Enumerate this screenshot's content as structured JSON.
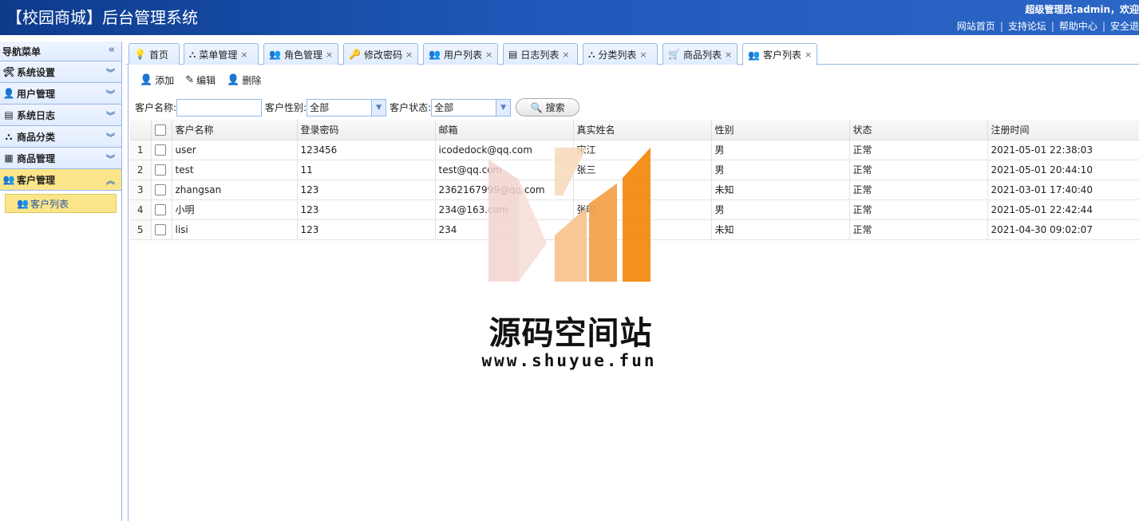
{
  "header": {
    "title": "【校园商城】后台管理系统",
    "user_info": "超级管理员:admin，欢迎",
    "links": [
      "网站首页",
      "支持论坛",
      "帮助中心",
      "安全退"
    ]
  },
  "sidebar": {
    "title": "导航菜单",
    "items": [
      {
        "label": "系统设置",
        "icon": "tools-icon"
      },
      {
        "label": "用户管理",
        "icon": "user-icon"
      },
      {
        "label": "系统日志",
        "icon": "log-icon"
      },
      {
        "label": "商品分类",
        "icon": "category-icon"
      },
      {
        "label": "商品管理",
        "icon": "goods-icon"
      },
      {
        "label": "客户管理",
        "icon": "customer-icon",
        "active": true
      }
    ],
    "sub_items": [
      {
        "label": "客户列表",
        "icon": "customer-list-icon"
      }
    ]
  },
  "tabs": [
    {
      "label": "首页",
      "icon": "bulb-icon",
      "closable": false
    },
    {
      "label": "菜单管理",
      "icon": "menu-tree-icon",
      "closable": true
    },
    {
      "label": "角色管理",
      "icon": "role-icon",
      "closable": true
    },
    {
      "label": "修改密码",
      "icon": "password-icon",
      "closable": true
    },
    {
      "label": "用户列表",
      "icon": "user-list-icon",
      "closable": true
    },
    {
      "label": "日志列表",
      "icon": "log-list-icon",
      "closable": true
    },
    {
      "label": "分类列表",
      "icon": "category-list-icon",
      "closable": true
    },
    {
      "label": "商品列表",
      "icon": "cart-icon",
      "closable": true
    },
    {
      "label": "客户列表",
      "icon": "customer-list-icon",
      "closable": true,
      "active": true
    }
  ],
  "toolbar": {
    "add": "添加",
    "edit": "编辑",
    "delete": "删除"
  },
  "filters": {
    "name_label": "客户名称:",
    "name_value": "",
    "gender_label": "客户性别:",
    "gender_value": "全部",
    "status_label": "客户状态:",
    "status_value": "全部",
    "search_label": "搜索"
  },
  "grid": {
    "columns": [
      "客户名称",
      "登录密码",
      "邮箱",
      "真实姓名",
      "性别",
      "状态",
      "注册时间"
    ],
    "rows": [
      {
        "num": "1",
        "name": "user",
        "password": "123456",
        "email": "icodedock@qq.com",
        "realname": "宋江",
        "gender": "男",
        "status": "正常",
        "time": "2021-05-01 22:38:03"
      },
      {
        "num": "2",
        "name": "test",
        "password": "11",
        "email": "test@qq.com",
        "realname": "张三",
        "gender": "男",
        "status": "正常",
        "time": "2021-05-01 20:44:10"
      },
      {
        "num": "3",
        "name": "zhangsan",
        "password": "123",
        "email": "2362167999@qq.com",
        "realname": "",
        "gender": "未知",
        "status": "正常",
        "time": "2021-03-01 17:40:40"
      },
      {
        "num": "4",
        "name": "小明",
        "password": "123",
        "email": "234@163.com",
        "realname": "张明",
        "gender": "男",
        "status": "正常",
        "time": "2021-05-01 22:42:44"
      },
      {
        "num": "5",
        "name": "lisi",
        "password": "123",
        "email": "234",
        "realname": "",
        "gender": "未知",
        "status": "正常",
        "time": "2021-04-30 09:02:07"
      }
    ]
  },
  "watermark": {
    "title": "源码空间站",
    "url": "www.shuyue.fun"
  }
}
